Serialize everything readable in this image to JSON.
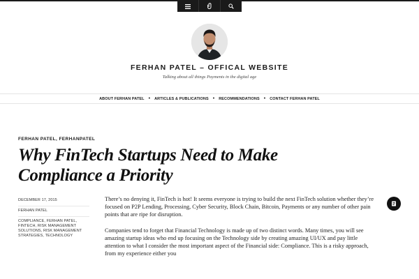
{
  "toolbar": {
    "items": [
      {
        "icon": "menu-icon"
      },
      {
        "icon": "link-icon"
      },
      {
        "icon": "search-icon"
      }
    ]
  },
  "site": {
    "title": "FERHAN PATEL – OFFICAL WEBSITE",
    "tagline": "Talking about all things Payments in the digital age",
    "avatar_icon": "profile-photo"
  },
  "nav": {
    "items": [
      {
        "label": "About Ferhan Patel"
      },
      {
        "label": "Articles & Publications"
      },
      {
        "label": "Recommendations"
      },
      {
        "label": "Contact Ferhan Patel"
      }
    ]
  },
  "post": {
    "categories": "Ferhan Patel, FerhanPatel",
    "title": "Why FinTech Startups Need to Make Compliance a Priority",
    "date": "December 17, 2015",
    "author": "Ferhan Patel",
    "tags": "Compliance, Ferhan Patel, FinTech, Risk Management Solutions, Risk Management Strategies, Technology",
    "paragraphs": [
      "There’s no denying it, FinTech is hot!  It seems everyone is trying to build the next FinTech solution whether they’re focused on P2P Lending, Processing, Cyber Security, Block Chain, Bitcoin, Payments or any number of other pain points that are ripe for disruption.",
      "Companies tend to forget that Financial Technology is made up of two distinct words. Many times, you will see amazing startup ideas who end up focusing on the Technology side by creating amazing UI/UX and pay little attention to what I consider the most important aspect of the Financial side: Compliance.  This is a risky approach, from my experience either you"
    ]
  },
  "colors": {
    "toolbar_bg": "#1a1a1a",
    "text": "#1a1a1a",
    "fab_bg": "#111111"
  },
  "fab": {
    "icon": "format-list-icon"
  }
}
